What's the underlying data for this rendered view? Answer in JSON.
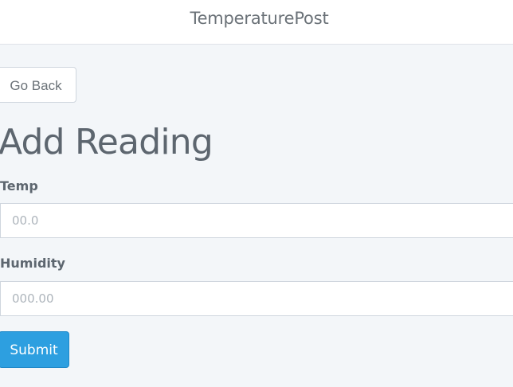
{
  "navbar": {
    "brand": "TemperaturePost"
  },
  "actions": {
    "back_label": "Go Back"
  },
  "page": {
    "title": "Add Reading"
  },
  "form": {
    "temp": {
      "label": "Temp",
      "value": "",
      "placeholder": "00.0"
    },
    "humidity": {
      "label": "Humidity",
      "value": "",
      "placeholder": "000.00"
    },
    "submit_label": "Submit"
  },
  "colors": {
    "page_background": "#f3f6f9",
    "navbar_background": "#ffffff",
    "submit_background": "#2d9fe0",
    "text": "#5d666f",
    "border": "#cfd6de"
  }
}
